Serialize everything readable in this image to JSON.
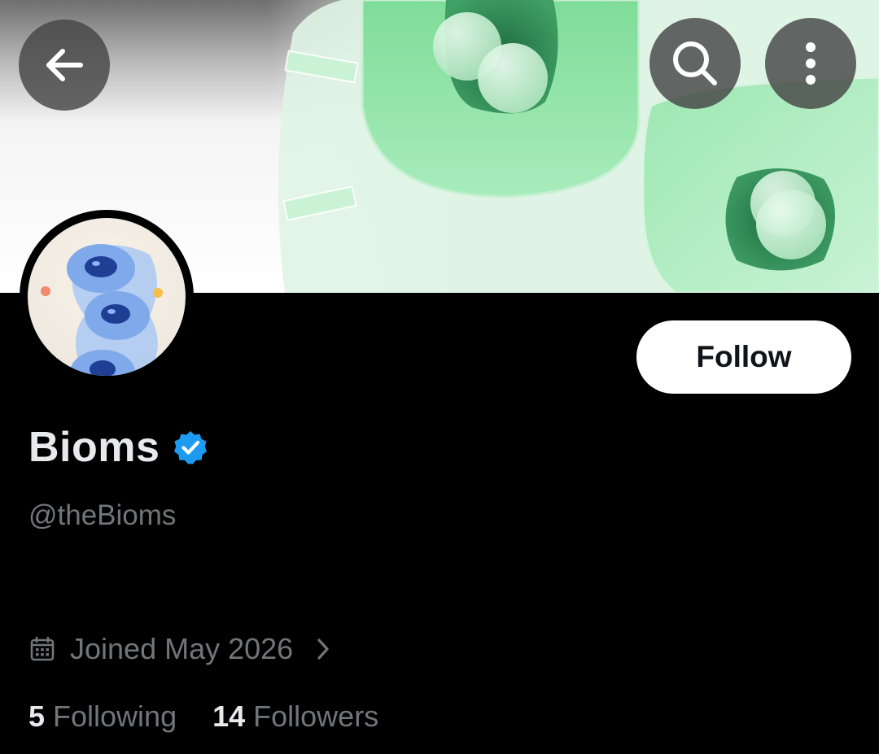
{
  "header": {
    "back_icon": "arrow-left-icon",
    "search_icon": "search-icon",
    "more_icon": "more-vertical-icon"
  },
  "profile": {
    "name": "Bioms",
    "verified_icon": "verified-badge-icon",
    "handle": "@theBioms",
    "joined": "Joined May 2026",
    "calendar_icon": "calendar-icon",
    "chevron_icon": "chevron-right-icon",
    "following_count": "5",
    "following_label": "Following",
    "followers_count": "14",
    "followers_label": "Followers"
  },
  "actions": {
    "follow_label": "Follow"
  },
  "colors": {
    "background": "#000000",
    "primary_text": "#e7e9ea",
    "secondary_text": "#71767b",
    "verified_blue": "#1d9bf0",
    "follow_button_bg": "#ffffff",
    "banner_green": "#8fe0a8"
  }
}
